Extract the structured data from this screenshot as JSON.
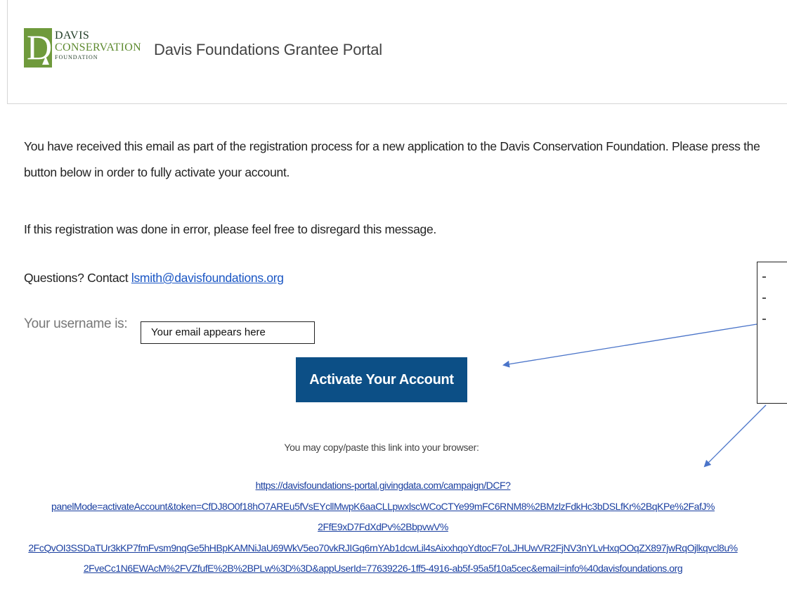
{
  "header": {
    "logo": {
      "letter": "D",
      "line1": "DAVIS",
      "line2": "CONSERVATION",
      "line3": "FOUNDATION"
    },
    "portal_title": "Davis Foundations Grantee Portal"
  },
  "body": {
    "intro": "You have received this email as part of the registration process for a new application to the Davis Conservation Foundation. Please press the button below in order to fully activate your account.",
    "error_note": "If this registration was done in error, please feel free to disregard this message.",
    "questions_prefix": "Questions?  Contact ",
    "contact_email": "lsmith@davisfoundations.org",
    "username_label": "Your username is:",
    "username_placeholder": "Your email appears here",
    "activate_button": "Activate Your Account",
    "copy_note": "You may copy/paste this link into your browser:",
    "link_lines": [
      "https://davisfoundations-portal.givingdata.com/campaign/DCF?",
      "panelMode=activateAccount&token=CfDJ8O0f18hO7AREu5fVsEYcllMwpK6aaCLLpwxlscWCoCTYe99mFC6RNM8%2BMzlzFdkHc3bDSLfKr%2BqKPe%2FafJ%",
      "2FfE9xD7FdXdPv%2BbpvwV%",
      "2FcQvOI3SSDaTUr3kKP7fmFvsm9nqGe5hHBpKAMNiJaU69WkV5eo70vkRJIGq6rnYAb1dcwLil4sAixxhqoYdtocF7oLJHUwVR2FjNV3nYLvHxqOOqZX897jwRqOjlkqvcl8u%",
      "2FveCc1N6EWAcM%2FVZfufE%2B%2BPLw%3D%3D&appUserId=77639226-1ff5-4916-ab5f-95a5f10a5cec&email=info%40davisfoundations.org"
    ]
  },
  "colors": {
    "brand_green": "#6f9a3c",
    "button_blue": "#0c4f86",
    "link_blue": "#1a56c4"
  }
}
